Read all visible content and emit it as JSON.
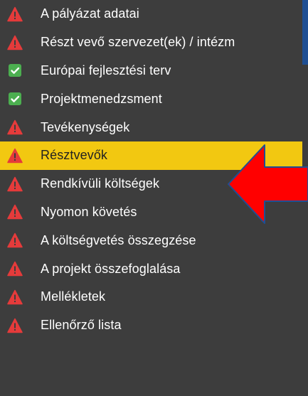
{
  "sidebar": {
    "items": [
      {
        "label": "A pályázat adatai",
        "status": "warning"
      },
      {
        "label": "Részt vevő szervezet(ek) / intézm",
        "status": "warning"
      },
      {
        "label": "Európai fejlesztési terv",
        "status": "complete"
      },
      {
        "label": "Projektmenedzsment",
        "status": "complete"
      },
      {
        "label": "Tevékenységek",
        "status": "warning"
      },
      {
        "label": "Résztvevők",
        "status": "warning",
        "highlighted": true
      },
      {
        "label": "Rendkívüli költségek",
        "status": "warning"
      },
      {
        "label": "Nyomon követés",
        "status": "warning"
      },
      {
        "label": "A költségvetés összegzése",
        "status": "warning"
      },
      {
        "label": "A projekt összefoglalása",
        "status": "warning"
      },
      {
        "label": "Mellékletek",
        "status": "warning"
      },
      {
        "label": "Ellenőrző lista",
        "status": "warning"
      }
    ]
  },
  "icons": {
    "warning": "warning-triangle-icon",
    "complete": "checkmark-icon",
    "annotation": "red-arrow-icon"
  },
  "colors": {
    "sidebar_background": "#3d3d3d",
    "highlight_background": "#f2c811",
    "warning_icon": "#e53b3b",
    "complete_icon": "#4caf50",
    "annotation_arrow": "#ff0000",
    "accent": "#1f4f93"
  }
}
